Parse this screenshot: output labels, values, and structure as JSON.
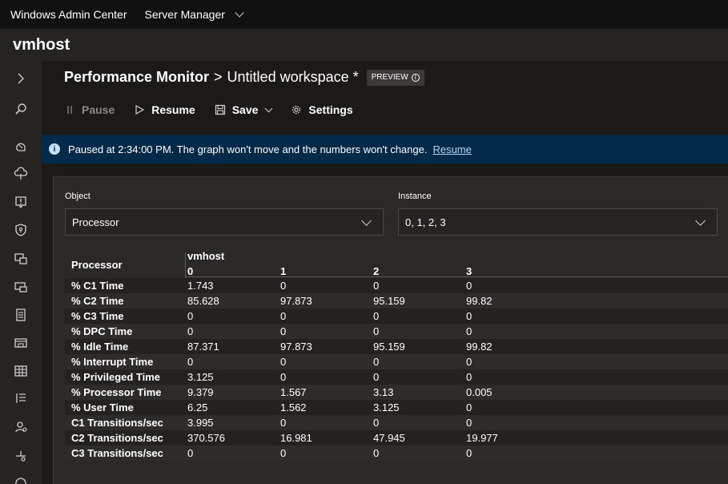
{
  "topbar": {
    "app_name": "Windows Admin Center",
    "tool_name": "Server Manager"
  },
  "host": {
    "name": "vmhost"
  },
  "nav": {
    "icons": [
      "expand-icon",
      "search-icon",
      "overview-icon",
      "cloud-icon",
      "alerts-icon",
      "security-icon",
      "apps-icon",
      "devices-icon",
      "events-icon",
      "files-icon",
      "network-icon",
      "list-icon",
      "users-icon",
      "settings-icon",
      "performance-icon"
    ]
  },
  "page": {
    "title": "Performance Monitor",
    "separator": ">",
    "subtitle": "Untitled workspace *",
    "badge": "PREVIEW"
  },
  "toolbar": {
    "pause_label": "Pause",
    "resume_label": "Resume",
    "save_label": "Save",
    "settings_label": "Settings"
  },
  "infobar": {
    "message": "Paused at 2:34:00 PM. The graph won't move and the numbers won't change.",
    "link": "Resume"
  },
  "filters": {
    "object_label": "Object",
    "object_value": "Processor",
    "instance_label": "Instance",
    "instance_value": "0, 1, 2, 3"
  },
  "table": {
    "object_header": "Processor",
    "host_header": "vmhost",
    "columns": [
      "0",
      "1",
      "2",
      "3"
    ],
    "rows": [
      {
        "name": "% C1 Time",
        "values": [
          "1.743",
          "0",
          "0",
          "0"
        ]
      },
      {
        "name": "% C2 Time",
        "values": [
          "85.628",
          "97.873",
          "95.159",
          "99.82"
        ]
      },
      {
        "name": "% C3 Time",
        "values": [
          "0",
          "0",
          "0",
          "0"
        ]
      },
      {
        "name": "% DPC Time",
        "values": [
          "0",
          "0",
          "0",
          "0"
        ]
      },
      {
        "name": "% Idle Time",
        "values": [
          "87.371",
          "97.873",
          "95.159",
          "99.82"
        ]
      },
      {
        "name": "% Interrupt Time",
        "values": [
          "0",
          "0",
          "0",
          "0"
        ]
      },
      {
        "name": "% Privileged Time",
        "values": [
          "3.125",
          "0",
          "0",
          "0"
        ]
      },
      {
        "name": "% Processor Time",
        "values": [
          "9.379",
          "1.567",
          "3.13",
          "0.005"
        ]
      },
      {
        "name": "% User Time",
        "values": [
          "6.25",
          "1.562",
          "3.125",
          "0"
        ]
      },
      {
        "name": "C1 Transitions/sec",
        "values": [
          "3.995",
          "0",
          "0",
          "0"
        ]
      },
      {
        "name": "C2 Transitions/sec",
        "values": [
          "370.576",
          "16.981",
          "47.945",
          "19.977"
        ]
      },
      {
        "name": "C3 Transitions/sec",
        "values": [
          "0",
          "0",
          "0",
          "0"
        ]
      }
    ]
  },
  "colors": {
    "accent": "#0078d4",
    "infobar_bg": "#042a49",
    "link": "#b3d6f9"
  }
}
